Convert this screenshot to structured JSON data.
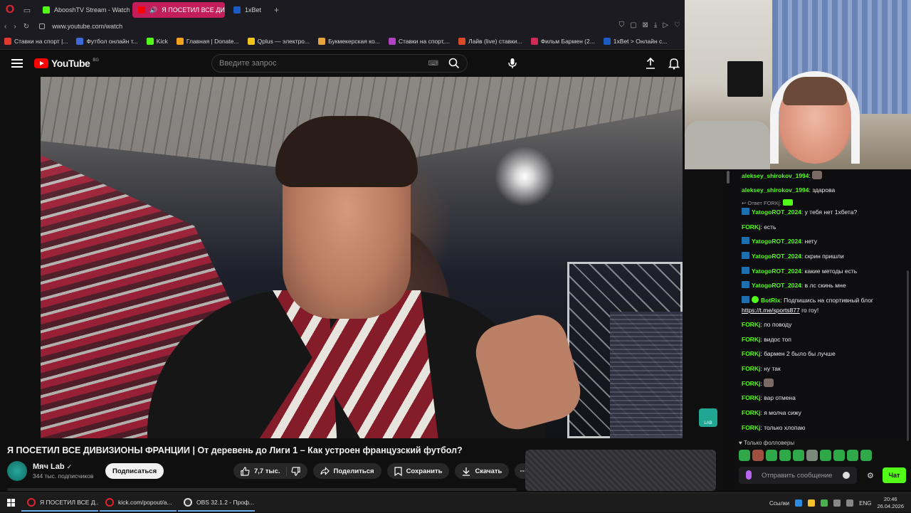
{
  "browser": {
    "tabs": [
      {
        "label": "AbooshTV Stream - Watch",
        "color": "#53fc18",
        "active": false
      },
      {
        "label": "Я ПОСЕТИЛ ВСЕ ДИВ",
        "color": "#ff0000",
        "active": true
      },
      {
        "label": "1xBet",
        "color": "#1a5bc4",
        "active": false
      }
    ],
    "url": "www.youtube.com/watch",
    "bookmarks": [
      {
        "label": "Ставки на спорт |...",
        "color": "#e03a2e"
      },
      {
        "label": "Футбол онлайн т...",
        "color": "#3b6bd8"
      },
      {
        "label": "Kick",
        "color": "#53fc18"
      },
      {
        "label": "Главная | Donate...",
        "color": "#f4a21b"
      },
      {
        "label": "Qplus — электро...",
        "color": "#f0c419"
      },
      {
        "label": "Букмекерская ко...",
        "color": "#e8a43c"
      },
      {
        "label": "Ставки на спорт,...",
        "color": "#b043c2"
      },
      {
        "label": "Лайв (live) ставки...",
        "color": "#d94a2a"
      },
      {
        "label": "Фильм Бармен (2...",
        "color": "#d12a54"
      },
      {
        "label": "1xBet > Онлайн с...",
        "color": "#1a5bc4"
      }
    ]
  },
  "youtube": {
    "logo_text": "YouTube",
    "region": "BG",
    "search_placeholder": "Введите запрос",
    "video_title": "Я ПОСЕТИЛ ВСЕ ДИВИЗИОНЫ ФРАНЦИИ | От деревень до Лиги 1 – Как устроен французский футбол?",
    "channel_name": "Мяч Lab",
    "subscribers": "344 тыс. подписчиков",
    "subscribe_label": "Подписаться",
    "likes": "7,7 тыс.",
    "share_label": "Поделиться",
    "save_label": "Сохранить",
    "download_label": "Скачать",
    "more_label": "⋯",
    "watermark": "LAB"
  },
  "chat": {
    "messages": [
      {
        "user": "aleksey_shirokov_1994",
        "text": "",
        "emote": true,
        "badge": false
      },
      {
        "user": "aleksey_shirokov_1994",
        "text": "здарова",
        "emote": false,
        "badge": false
      },
      {
        "user": "YatogoROT_2024",
        "text": "у тебя нет 1xбета?",
        "emote": false,
        "badge": true
      },
      {
        "user": "FORKj",
        "text": "есть",
        "emote": false,
        "badge": false
      },
      {
        "user": "YatogoROT_2024",
        "text": "нету",
        "emote": false,
        "badge": true
      },
      {
        "user": "YatogoROT_2024",
        "text": "скрин пришли",
        "emote": false,
        "badge": true
      },
      {
        "user": "YatogoROT_2024",
        "text": "какие методы есть",
        "emote": false,
        "badge": true
      },
      {
        "user": "YatogoROT_2024",
        "text": "в лс скинь мне",
        "emote": false,
        "badge": true
      },
      {
        "user": "BotRix",
        "text": "Подпишись на спортивный блог",
        "link": "https://t.me/sports877",
        "after": "го гоу!",
        "emote": false,
        "badge": true
      },
      {
        "user": "FORKj",
        "text": "по поводу",
        "emote": false,
        "badge": false
      },
      {
        "user": "FORKj",
        "text": "видос топ",
        "emote": false,
        "badge": false
      },
      {
        "user": "FORKj",
        "text": "бармен 2 было бы лучше",
        "emote": false,
        "badge": false
      },
      {
        "user": "FORKj",
        "text": "ну так",
        "emote": false,
        "badge": false
      },
      {
        "user": "FORKj",
        "text": "",
        "emote": true,
        "badge": false
      },
      {
        "user": "FORKj",
        "text": "вар отмена",
        "emote": false,
        "badge": false
      },
      {
        "user": "FORKj",
        "text": "я молча сижу",
        "emote": false,
        "badge": false
      },
      {
        "user": "FORKj",
        "text": "только хлопаю",
        "emote": false,
        "badge": false
      }
    ],
    "reply_to": "Ответ FORKj:",
    "followers_only": "Только фолловеры",
    "input_placeholder": "Отправить сообщение",
    "send_label": "Чат",
    "accent": "#53fc18"
  },
  "taskbar": {
    "items": [
      {
        "label": "Я ПОСЕТИЛ ВСЕ Д..."
      },
      {
        "label": "kick.com/popout/a..."
      },
      {
        "label": "OBS 32.1.2 - Проф..."
      }
    ],
    "links_label": "Ссылки",
    "lang": "ENG",
    "time": "20:46",
    "date": "26.04.2026"
  }
}
